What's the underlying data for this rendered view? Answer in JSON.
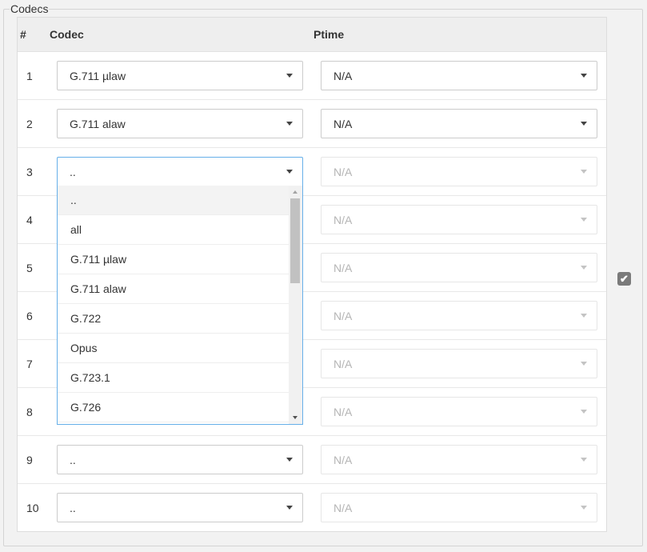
{
  "fieldset": {
    "legend": "Codecs"
  },
  "headers": {
    "num": "#",
    "codec": "Codec",
    "ptime": "Ptime"
  },
  "rows": [
    {
      "num": "1",
      "codec": "G.711 µlaw",
      "ptime": "N/A"
    },
    {
      "num": "2",
      "codec": "G.711 alaw",
      "ptime": "N/A"
    },
    {
      "num": "3",
      "codec": "..",
      "ptime": "N/A"
    },
    {
      "num": "4",
      "codec": "",
      "ptime": "N/A"
    },
    {
      "num": "5",
      "codec": "",
      "ptime": "N/A"
    },
    {
      "num": "6",
      "codec": "",
      "ptime": "N/A"
    },
    {
      "num": "7",
      "codec": "",
      "ptime": "N/A"
    },
    {
      "num": "8",
      "codec": "",
      "ptime": "N/A"
    },
    {
      "num": "9",
      "codec": "..",
      "ptime": "N/A"
    },
    {
      "num": "10",
      "codec": "..",
      "ptime": "N/A"
    }
  ],
  "dropdown": {
    "options": [
      "..",
      "all",
      "G.711 µlaw",
      "G.711 alaw",
      "G.722",
      "Opus",
      "G.723.1",
      "G.726"
    ],
    "highlighted_index": 0
  },
  "checkbox": {
    "checked": true,
    "icon": "check-icon"
  }
}
